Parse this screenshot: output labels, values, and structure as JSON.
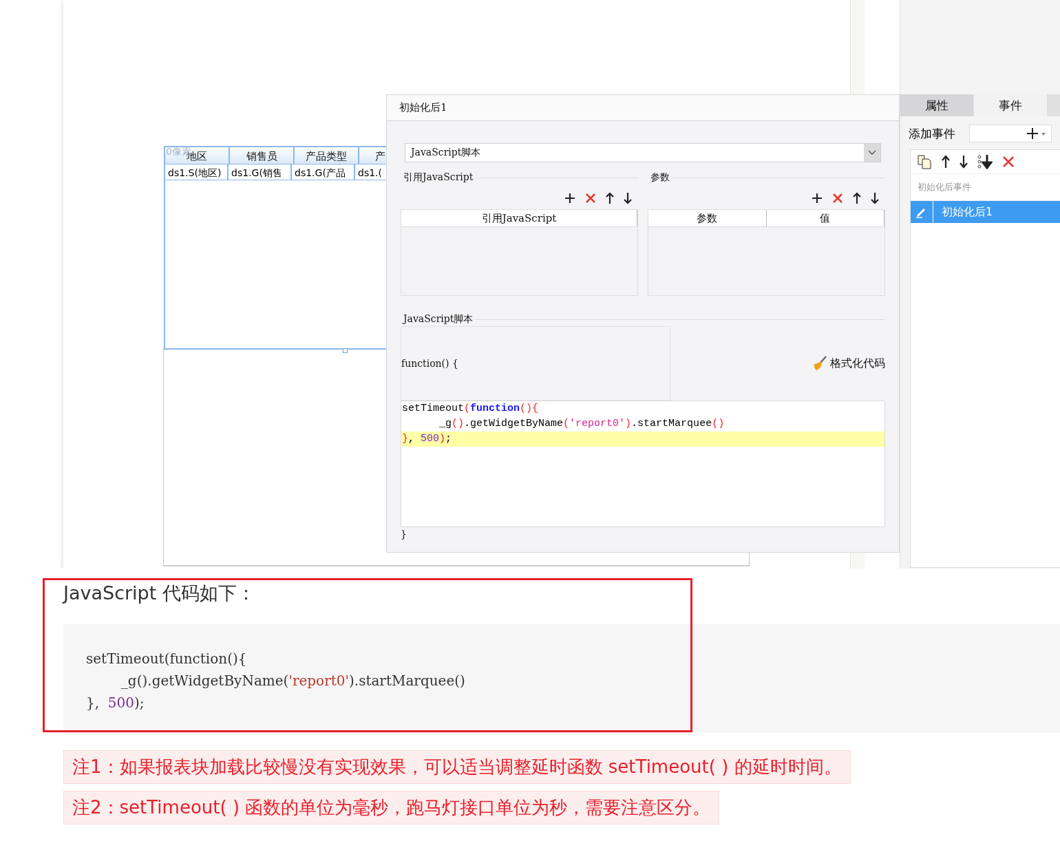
{
  "report": {
    "overlay_label": "0像素",
    "header": [
      "地区",
      "销售员",
      "产品类型",
      "产"
    ],
    "cells": [
      "ds1.S(地区)",
      "ds1.G(销售",
      "ds1.G(产品",
      "ds1.("
    ]
  },
  "dialog": {
    "title": "初始化后1",
    "script_type": "JavaScript脚本",
    "ref_section": {
      "title": "引用JavaScript",
      "columns": [
        "引用JavaScript"
      ]
    },
    "param_section": {
      "title": "参数",
      "columns": [
        "参数",
        "值"
      ]
    },
    "script_section": {
      "title": "JavaScript脚本",
      "function_header": "function() {",
      "format_button": "格式化代码",
      "closing": "}",
      "lines": [
        {
          "highlighted": false,
          "tokens": [
            {
              "text": "setTimeout",
              "kind": "plain"
            },
            {
              "text": "(",
              "kind": "paren"
            },
            {
              "text": "function",
              "kind": "keyword"
            },
            {
              "text": "(){",
              "kind": "paren"
            }
          ]
        },
        {
          "highlighted": false,
          "tokens": [
            {
              "text": "      _g",
              "kind": "plain"
            },
            {
              "text": "()",
              "kind": "paren"
            },
            {
              "text": ".getWidgetByName",
              "kind": "plain"
            },
            {
              "text": "(",
              "kind": "paren"
            },
            {
              "text": "'report0'",
              "kind": "string"
            },
            {
              "text": ")",
              "kind": "paren"
            },
            {
              "text": ".startMarquee",
              "kind": "plain"
            },
            {
              "text": "()",
              "kind": "paren"
            }
          ]
        },
        {
          "highlighted": true,
          "tokens": [
            {
              "text": "}",
              "kind": "paren"
            },
            {
              "text": ", ",
              "kind": "plain"
            },
            {
              "text": "500",
              "kind": "number"
            },
            {
              "text": ")",
              "kind": "paren"
            },
            {
              "text": ";",
              "kind": "plain"
            }
          ]
        }
      ]
    }
  },
  "side_panel": {
    "tabs": [
      {
        "label": "属性",
        "selected": false
      },
      {
        "label": "事件",
        "selected": true
      }
    ],
    "add_event_label": "添加事件",
    "group_label": "初始化后事件",
    "events": [
      {
        "label": "初始化后1",
        "selected": true
      }
    ]
  },
  "doc": {
    "heading": "JavaScript 代码如下：",
    "code_lines": [
      [
        {
          "text": "setTimeout(function(){",
          "kind": "plain"
        }
      ],
      [
        {
          "text": "        _g().getWidgetByName(",
          "kind": "plain"
        },
        {
          "text": "'report0'",
          "kind": "string"
        },
        {
          "text": ").startMarquee()",
          "kind": "plain"
        }
      ],
      [
        {
          "text": "},  ",
          "kind": "plain"
        },
        {
          "text": "500",
          "kind": "number"
        },
        {
          "text": ");",
          "kind": "plain"
        }
      ]
    ],
    "notes": [
      "注1：如果报表块加载比较慢没有实现效果，可以适当调整延时函数 setTimeout( ) 的延时时间。",
      "注2：setTimeout( ) 函数的单位为毫秒，跑马灯接口单位为秒，需要注意区分。"
    ]
  }
}
